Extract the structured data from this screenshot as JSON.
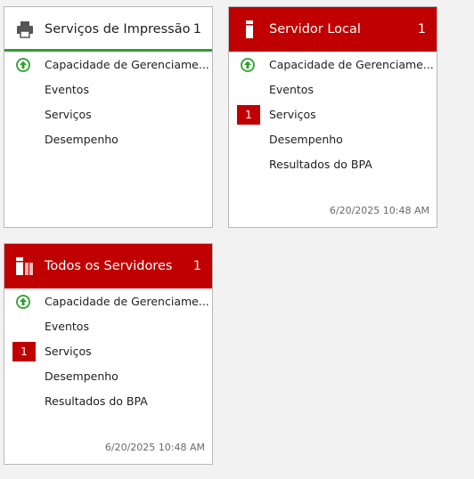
{
  "tiles": {
    "print": {
      "title": "Serviços de Impressão",
      "count": "1",
      "rows": [
        "Capacidade de Gerenciame...",
        "Eventos",
        "Serviços",
        "Desempenho"
      ]
    },
    "local": {
      "title": "Servidor Local",
      "count": "1",
      "rows": [
        "Capacidade de Gerenciame...",
        "Eventos",
        "Serviços",
        "Desempenho",
        "Resultados do BPA"
      ],
      "services_badge": "1",
      "timestamp": "6/20/2025 10:48 AM"
    },
    "all": {
      "title": "Todos os Servidores",
      "count": "1",
      "rows": [
        "Capacidade de Gerenciame...",
        "Eventos",
        "Serviços",
        "Desempenho",
        "Resultados do BPA"
      ],
      "services_badge": "1",
      "timestamp": "6/20/2025 10:48 AM"
    }
  },
  "colors": {
    "alert": "#c00000",
    "ok": "#2ca02c"
  }
}
